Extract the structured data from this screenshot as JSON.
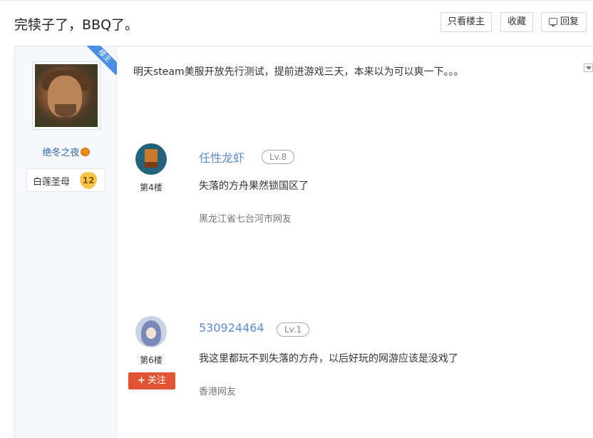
{
  "header": {
    "title": "完犊子了，BBQ了。",
    "only_op_label": "只看楼主",
    "collect_label": "收藏",
    "reply_label": "回复"
  },
  "author": {
    "ribbon_label": "楼主",
    "name": "绝冬之夜",
    "badge_title": "白莲圣母",
    "badge_level": "12",
    "avatar_icon": "portrait-avatar",
    "name_icon": "pumpkin-icon"
  },
  "post": {
    "content": "明天steam美服开放先行测试，提前进游戏三天，本来以为可以爽一下。。。"
  },
  "replies": [
    {
      "name": "任性龙虾",
      "level": "Lv.8",
      "floor": "第4楼",
      "text": "失落的方舟果然锁国区了",
      "location": "黑龙江省七台河市网友"
    },
    {
      "name": "530924464",
      "level": "Lv.1",
      "floor": "第6楼",
      "follow_label": "关注",
      "text": "我这里都玩不到失落的方舟，以后好玩的网游应该是没戏了",
      "location": "香港网友"
    }
  ],
  "colors": {
    "link_blue": "#2d64b3",
    "reply_name": "#5f8ad0",
    "follow_red": "#e05433",
    "op_ribbon": "#4a90e2",
    "author_bg": "#f6f8fc"
  }
}
